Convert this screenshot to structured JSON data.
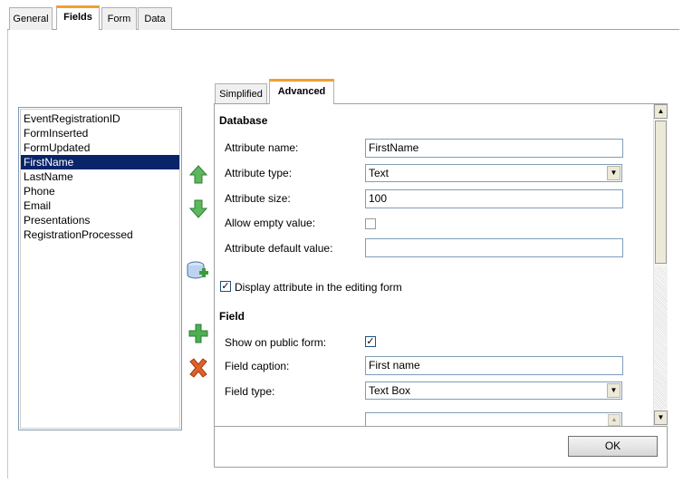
{
  "top_tabs": [
    {
      "label": "General"
    },
    {
      "label": "Fields"
    },
    {
      "label": "Form"
    },
    {
      "label": "Data"
    }
  ],
  "field_list": {
    "items": [
      "EventRegistrationID",
      "FormInserted",
      "FormUpdated",
      "FirstName",
      "LastName",
      "Phone",
      "Email",
      "Presentations",
      "RegistrationProcessed"
    ],
    "selected": "FirstName"
  },
  "icons": {
    "move_up": "arrow-up-icon",
    "move_down": "arrow-down-icon",
    "new_from_database": "database-add-icon",
    "new_attribute": "plus-icon",
    "delete_attribute": "delete-x-icon"
  },
  "inner_tabs": [
    {
      "label": "Simplified"
    },
    {
      "label": "Advanced"
    }
  ],
  "database": {
    "title": "Database",
    "attribute_name_label": "Attribute name:",
    "attribute_name_value": "FirstName",
    "attribute_type_label": "Attribute type:",
    "attribute_type_value": "Text",
    "attribute_size_label": "Attribute size:",
    "attribute_size_value": "100",
    "allow_empty_label": "Allow empty value:",
    "allow_empty_checked": false,
    "default_value_label": "Attribute default value:",
    "default_value": ""
  },
  "display_in_editing_form": {
    "label": "Display attribute in the editing form",
    "checked": true
  },
  "field": {
    "title": "Field",
    "show_on_public_label": "Show on public form:",
    "show_on_public_checked": true,
    "caption_label": "Field caption:",
    "caption_value": "First name",
    "type_label": "Field type:",
    "type_value": "Text Box"
  },
  "ok_label": "OK",
  "colors": {
    "selection": "#0a246a",
    "tab_accent": "#f0a030",
    "input_border": "#7f9db9"
  }
}
